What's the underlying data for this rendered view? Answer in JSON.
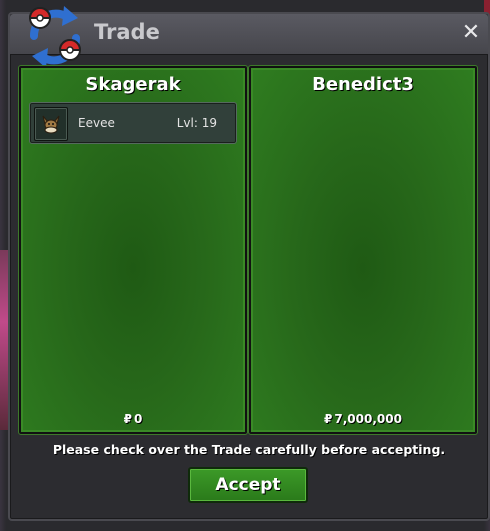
{
  "window": {
    "title": "Trade",
    "close_symbol": "✕",
    "logo_icon": "trade-arrows-pokeballs-icon"
  },
  "left_panel": {
    "player_name": "Skagerak",
    "currency_symbol": "₽",
    "money": "0",
    "items": [
      {
        "icon": "eevee-sprite-icon",
        "name": "Eevee",
        "level": "Lvl: 19"
      }
    ]
  },
  "right_panel": {
    "player_name": "Benedict3",
    "currency_symbol": "₽",
    "money": "7,000,000",
    "items": []
  },
  "notice": "Please check over the Trade carefully before accepting.",
  "accept_label": "Accept",
  "colors": {
    "panel_green": "#2f7d20",
    "accept_green": "#2a7a1a",
    "titlebar": "#46464c"
  }
}
